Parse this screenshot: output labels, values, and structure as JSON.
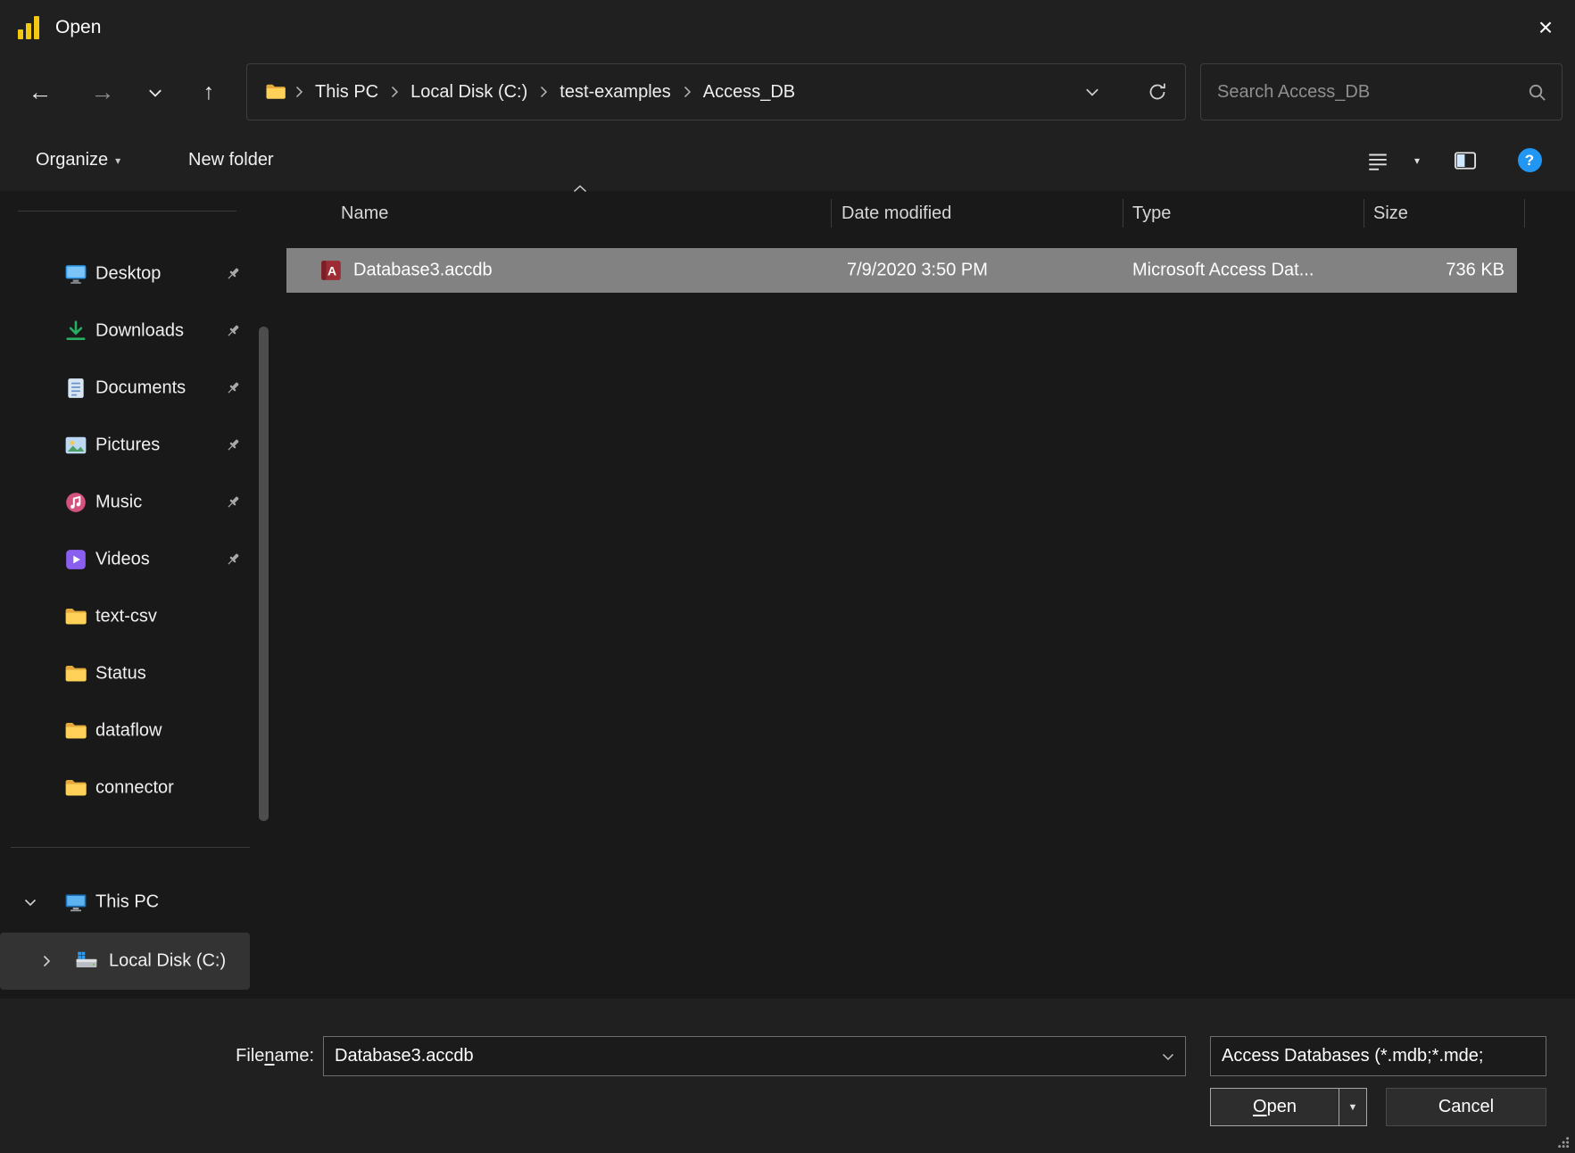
{
  "window": {
    "title": "Open"
  },
  "icons": {
    "close": "×",
    "back": "←",
    "forward": "→",
    "up": "↑",
    "organize_caret": "▾",
    "view_caret": "▾",
    "open_dropdown": "▼",
    "help": "?"
  },
  "breadcrumb": {
    "items": [
      "This PC",
      "Local Disk (C:)",
      "test-examples",
      "Access_DB"
    ]
  },
  "search": {
    "placeholder": "Search Access_DB"
  },
  "commandbar": {
    "organize_label": "Organize",
    "new_folder_label": "New folder"
  },
  "list": {
    "columns": [
      "Name",
      "Date modified",
      "Type",
      "Size"
    ],
    "files": [
      {
        "name": "Database3.accdb",
        "date_modified": "7/9/2020 3:50 PM",
        "type": "Microsoft Access Dat...",
        "size": "736 KB"
      }
    ]
  },
  "sidebar": {
    "quick": [
      {
        "label": "Desktop",
        "pinned": true
      },
      {
        "label": "Downloads",
        "pinned": true
      },
      {
        "label": "Documents",
        "pinned": true
      },
      {
        "label": "Pictures",
        "pinned": true
      },
      {
        "label": "Music",
        "pinned": true
      },
      {
        "label": "Videos",
        "pinned": true
      },
      {
        "label": "text-csv",
        "pinned": false
      },
      {
        "label": "Status",
        "pinned": false
      },
      {
        "label": "dataflow",
        "pinned": false
      },
      {
        "label": "connector",
        "pinned": false
      }
    ],
    "tree": [
      {
        "label": "This PC",
        "expanded": true
      },
      {
        "label": "Local Disk (C:)",
        "selected": true
      }
    ]
  },
  "footer": {
    "file_name_label_parts": [
      "File ",
      "n",
      "ame:"
    ],
    "file_name_value": "Database3.accdb",
    "file_type_value": "Access Databases (*.mdb;*.mde;",
    "open_label_parts": [
      "O",
      "pen"
    ],
    "cancel_label": "Cancel"
  },
  "colors": {
    "titlebar_bg": "#202020",
    "content_bg": "#191919",
    "selection_gray": "#828282",
    "accent_yellow": "#F2C811",
    "folder_yellow": "#FFD158",
    "access_red": "#9D2B33",
    "help_blue": "#2196F3"
  }
}
